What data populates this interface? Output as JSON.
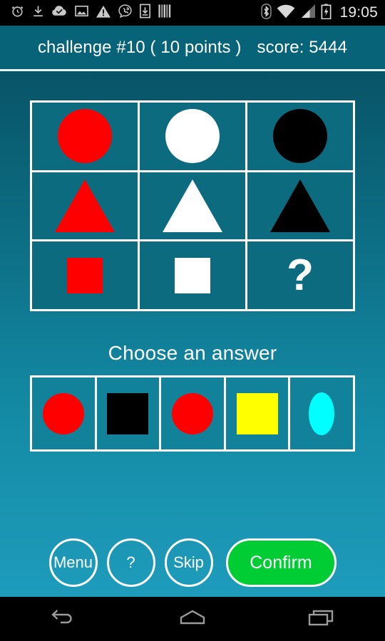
{
  "status_bar": {
    "time": "19:05",
    "left_icons": [
      "alarm-clock-icon",
      "download-icon",
      "cloud-check-icon",
      "image-icon",
      "warning-icon",
      "viber-call-icon",
      "download-to-device-icon",
      "barcode-icon"
    ],
    "right_icons": [
      "bluetooth-icon",
      "wifi-icon",
      "cellular-signal-icon",
      "battery-charging-icon"
    ]
  },
  "header": {
    "challenge": "challenge #10 ( 10 points )",
    "score": "score: 5444"
  },
  "colors": {
    "header_bg": "#076377",
    "bg_top": "#085466",
    "bg_bottom": "#1e9cbb",
    "cell_bg": "#0c6b7e",
    "answer_cell_bg": "#11829a",
    "border": "#ffffff",
    "red": "#ff0000",
    "white": "#ffffff",
    "black": "#000000",
    "yellow": "#ffff00",
    "cyan": "#00ffff",
    "confirm_green": "#00cc33"
  },
  "puzzle": {
    "rows": [
      [
        {
          "shape": "circle",
          "color": "#ff0000",
          "name": "red-circle"
        },
        {
          "shape": "circle",
          "color": "#ffffff",
          "name": "white-circle"
        },
        {
          "shape": "circle",
          "color": "#000000",
          "name": "black-circle"
        }
      ],
      [
        {
          "shape": "triangle",
          "color": "#ff0000",
          "name": "red-triangle"
        },
        {
          "shape": "triangle",
          "color": "#ffffff",
          "name": "white-triangle"
        },
        {
          "shape": "triangle",
          "color": "#000000",
          "name": "black-triangle"
        }
      ],
      [
        {
          "shape": "square",
          "color": "#ff0000",
          "name": "red-square"
        },
        {
          "shape": "square",
          "color": "#ffffff",
          "name": "white-square"
        },
        {
          "shape": "question",
          "color": "#ffffff",
          "name": "unknown-cell",
          "label": "?"
        }
      ]
    ]
  },
  "answers": {
    "prompt": "Choose an answer",
    "options": [
      {
        "shape": "circle",
        "color": "#ff0000",
        "name": "answer-red-circle"
      },
      {
        "shape": "square",
        "color": "#000000",
        "name": "answer-black-square"
      },
      {
        "shape": "circle",
        "color": "#ff0000",
        "name": "answer-red-circle-2"
      },
      {
        "shape": "square",
        "color": "#ffff00",
        "name": "answer-yellow-square"
      },
      {
        "shape": "ellipse",
        "color": "#00ffff",
        "name": "answer-cyan-ellipse"
      }
    ]
  },
  "buttons": {
    "menu": "Menu",
    "help": "?",
    "skip": "Skip",
    "confirm": "Confirm"
  },
  "nav_bar": {
    "back": "back-icon",
    "home": "home-icon",
    "recents": "recents-icon"
  }
}
